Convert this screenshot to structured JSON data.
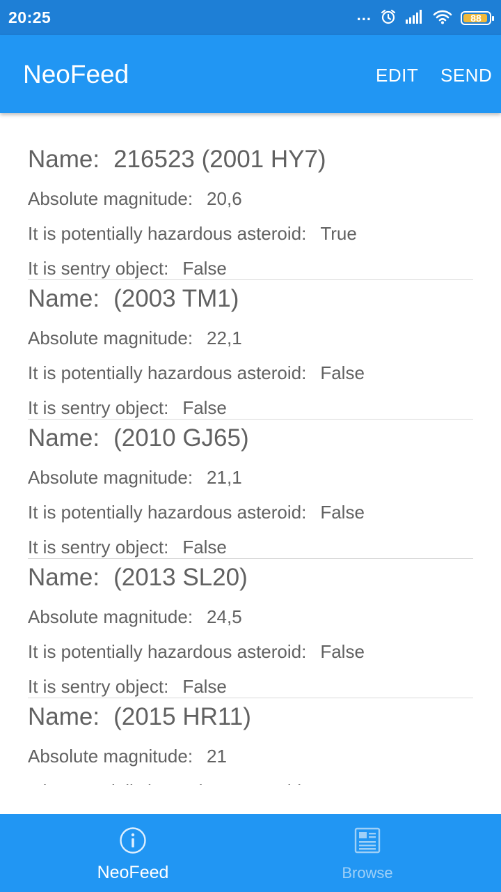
{
  "status_bar": {
    "time": "20:25",
    "dots": "...",
    "battery_level": "88",
    "icons": [
      "alarm-icon",
      "signal-icon",
      "wifi-icon",
      "battery-icon"
    ],
    "battery_color": "#f1b93a"
  },
  "app_bar": {
    "title": "NeoFeed",
    "actions": [
      "EDIT",
      "SEND"
    ],
    "color": "#2196f3"
  },
  "labels": {
    "name": "Name:",
    "magnitude": "Absolute magnitude:",
    "hazardous": "It is potentially hazardous asteroid:",
    "sentry": "It is sentry object:"
  },
  "asteroids": [
    {
      "name": "216523 (2001 HY7)",
      "magnitude": "20,6",
      "hazardous": "True",
      "sentry": "False"
    },
    {
      "name": "(2003 TM1)",
      "magnitude": "22,1",
      "hazardous": "False",
      "sentry": "False"
    },
    {
      "name": "(2010 GJ65)",
      "magnitude": "21,1",
      "hazardous": "False",
      "sentry": "False"
    },
    {
      "name": "(2013 SL20)",
      "magnitude": "24,5",
      "hazardous": "False",
      "sentry": "False"
    },
    {
      "name": "(2015 HR11)",
      "magnitude": "21",
      "hazardous": "",
      "sentry": ""
    }
  ],
  "bottom_nav": {
    "items": [
      {
        "label": "NeoFeed",
        "icon": "info-icon",
        "active": true
      },
      {
        "label": "Browse",
        "icon": "browse-icon",
        "active": false
      }
    ]
  }
}
